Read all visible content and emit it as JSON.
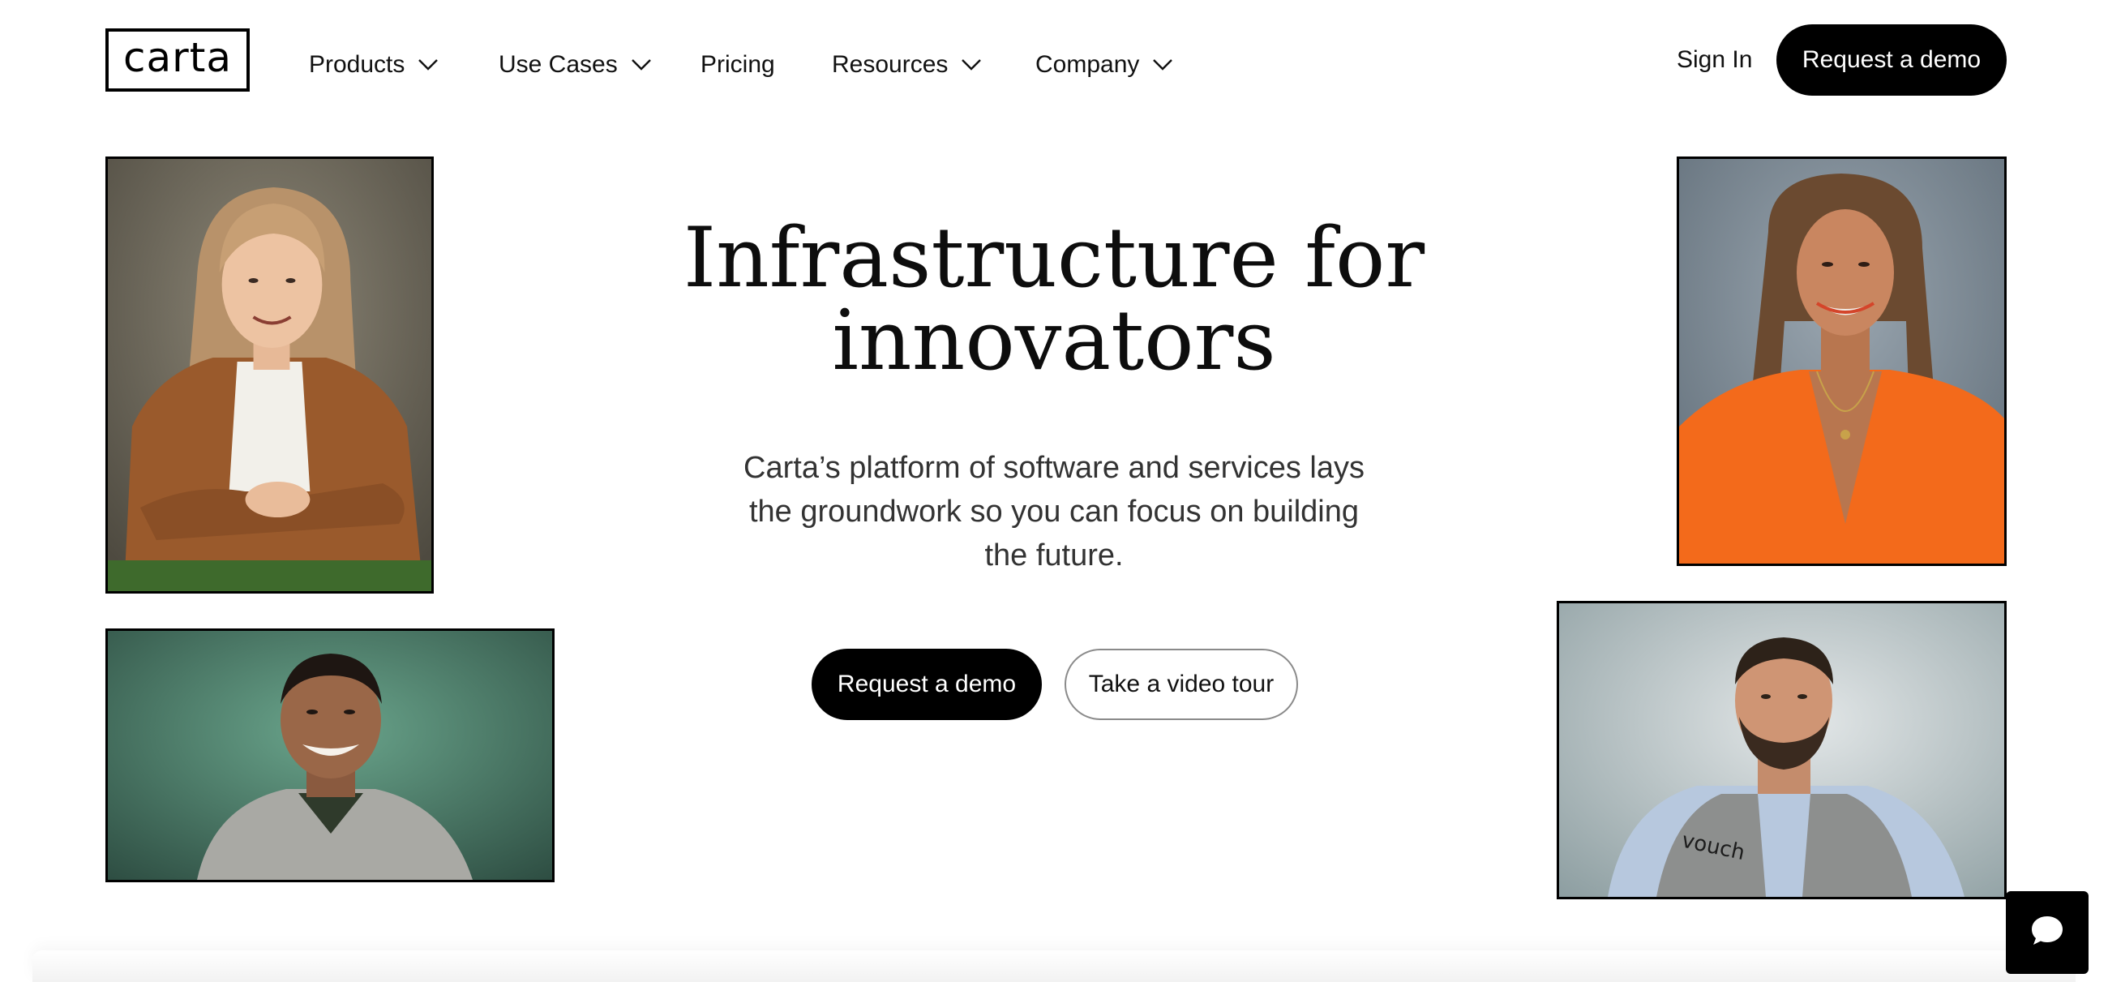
{
  "header": {
    "logo_text": "carta",
    "nav": [
      {
        "label": "Products",
        "has_dropdown": true
      },
      {
        "label": "Use Cases",
        "has_dropdown": true
      },
      {
        "label": "Pricing",
        "has_dropdown": false
      },
      {
        "label": "Resources",
        "has_dropdown": true
      },
      {
        "label": "Company",
        "has_dropdown": true
      }
    ],
    "sign_in_label": "Sign In",
    "demo_label": "Request a demo"
  },
  "hero": {
    "title_line1": "Infrastructure for",
    "title_line2": "innovators",
    "subtitle_line1": "Carta’s platform of software and services lays",
    "subtitle_line2": "the groundwork so you can focus on building",
    "subtitle_line3": "the future.",
    "primary_cta": "Request a demo",
    "secondary_cta": "Take a video tour"
  },
  "photos": {
    "vest_text": "vouch"
  },
  "colors": {
    "brand": "#000000",
    "background": "#ffffff",
    "button_text": "#ffffff"
  },
  "icons": {
    "nav_dropdown": "chevron-down-icon",
    "chat": "chat-bubble-icon"
  }
}
